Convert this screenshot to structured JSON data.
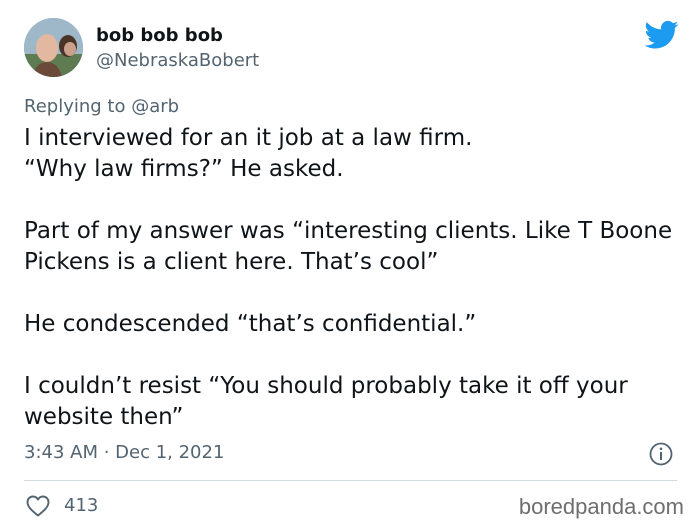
{
  "header": {
    "display_name": "bob bob bob",
    "handle": "@NebraskaBobert",
    "avatar_icon": "profile-photo",
    "platform_icon": "twitter-bird-icon",
    "accent_color": "#1d9bf0"
  },
  "reply": {
    "prefix": "Replying to",
    "mention": "@arb"
  },
  "tweet": {
    "paragraphs": [
      "I interviewed for an it job at a law firm.\n“Why law firms?” He asked.",
      "Part of my answer was “interesting clients. Like T Boone Pickens is a client here. That’s cool”",
      "He condescended “that’s confidential.”",
      "I couldn’t resist “You should probably take it off your website then”"
    ]
  },
  "meta": {
    "timestamp": "3:43 AM · Dec 1, 2021",
    "info_icon": "info-icon"
  },
  "actions": {
    "like_icon": "heart-icon",
    "like_count": "413"
  },
  "watermark": "boredpanda.com"
}
